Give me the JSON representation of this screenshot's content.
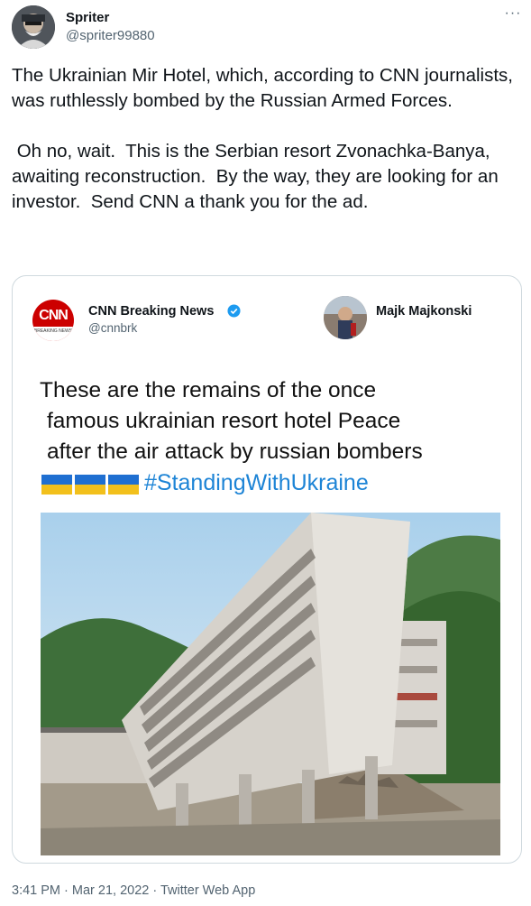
{
  "author": {
    "name": "Spriter",
    "handle": "@spriter99880"
  },
  "more_menu_glyph": "···",
  "tweet_text": "The Ukrainian Mir Hotel, which, according to CNN journalists, was ruthlessly bombed by the Russian Armed Forces.\n\n Oh no, wait.  This is the Serbian resort Zvonachka-Banya, awaiting reconstruction.  By the way, they are looking for an investor.  Send CNN a thank you for the ad.",
  "embedded": {
    "cnn_logo_text": "CNN",
    "cnn_logo_strip": "BREAKING NEWS",
    "cnn_name": "CNN Breaking News",
    "cnn_handle": "@cnnbrk",
    "other_user_name": "Majk Majkonski",
    "headline_line1": "These are the remains of the once",
    "headline_line2": "famous ukrainian resort hotel Peace",
    "headline_line3": "after the air attack by russian bombers",
    "flag_colors": [
      "#1f6fd1",
      "#f2c01c"
    ],
    "hashtag": "#StandingWithUkraine"
  },
  "timestamp": "3:41 PM · Mar 21, 2022 · Twitter Web App"
}
